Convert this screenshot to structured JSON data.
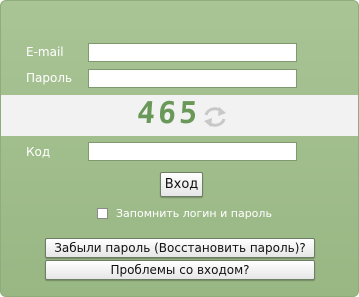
{
  "form": {
    "email_label": "E-mail",
    "password_label": "Пароль",
    "email_value": "",
    "password_value": "",
    "captcha_code": "465",
    "code_label": "Код",
    "code_value": "",
    "login_button": "Вход",
    "remember_label": "Запомнить логин и пароль",
    "remember_checked": false,
    "forgot_button": "Забыли пароль (Восстановить пароль)?",
    "problems_button": "Проблемы со входом?"
  },
  "colors": {
    "panel_bg": "#a3bf8f",
    "captcha_text": "#6a9859",
    "captcha_band": "#f2f2f2"
  },
  "icons": {
    "refresh": "refresh-icon"
  }
}
